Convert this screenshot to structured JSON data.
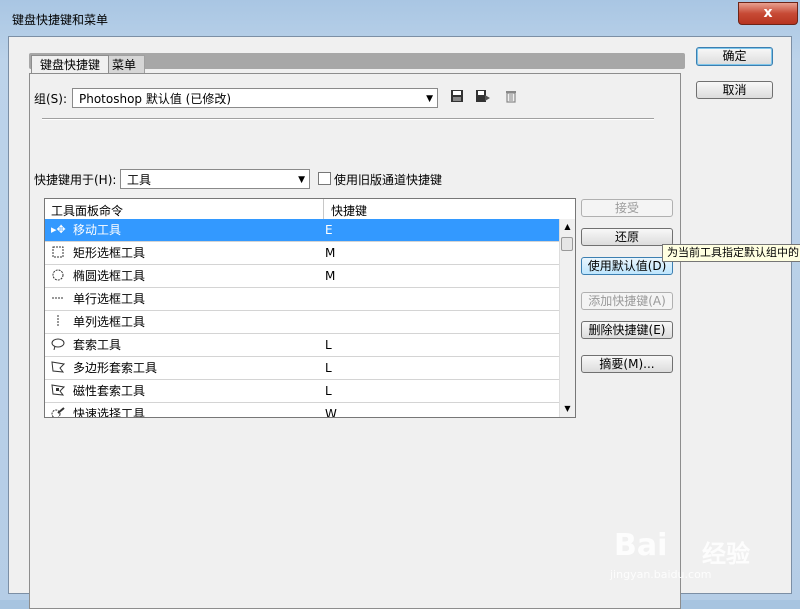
{
  "window": {
    "title": "键盘快捷键和菜单",
    "close": "x"
  },
  "tabs": [
    {
      "label": "键盘快捷键"
    },
    {
      "label": "菜单"
    }
  ],
  "group": {
    "label": "组(S):",
    "value": "Photoshop 默认值 (已修改)"
  },
  "icons": {
    "save": "save-icon",
    "save_as": "save-as-icon",
    "delete": "trash-icon"
  },
  "shortcuts_for": {
    "label": "快捷键用于(H):",
    "value": "工具"
  },
  "legacy_checkbox": {
    "label": "使用旧版通道快捷键",
    "checked": false
  },
  "list": {
    "headers": [
      "工具面板命令",
      "快捷键"
    ],
    "rows": [
      {
        "icon": "move-tool-icon",
        "name": "移动工具",
        "key": "E",
        "selected": true
      },
      {
        "icon": "rect-marquee-icon",
        "name": "矩形选框工具",
        "key": "M"
      },
      {
        "icon": "ellipse-marquee-icon",
        "name": "椭圆选框工具",
        "key": "M"
      },
      {
        "icon": "single-row-marquee-icon",
        "name": "单行选框工具",
        "key": ""
      },
      {
        "icon": "single-column-marquee-icon",
        "name": "单列选框工具",
        "key": ""
      },
      {
        "icon": "lasso-icon",
        "name": "套索工具",
        "key": "L"
      },
      {
        "icon": "polygon-lasso-icon",
        "name": "多边形套索工具",
        "key": "L"
      },
      {
        "icon": "magnetic-lasso-icon",
        "name": "磁性套索工具",
        "key": "L"
      },
      {
        "icon": "quick-select-icon",
        "name": "快速选择工具",
        "key": "W"
      }
    ]
  },
  "buttons": {
    "accept": "接受",
    "undo": "还原",
    "use_default": "使用默认值(D)",
    "add_shortcut": "添加快捷键(A)",
    "delete_shortcut": "删除快捷键(E)",
    "summarize": "摘要(M)...",
    "ok": "确定",
    "cancel": "取消"
  },
  "tooltip": "为当前工具指定默认组中的",
  "watermark": {
    "logo": "Bai",
    "brand": "经验",
    "url": "jingyan.baidu.com"
  }
}
